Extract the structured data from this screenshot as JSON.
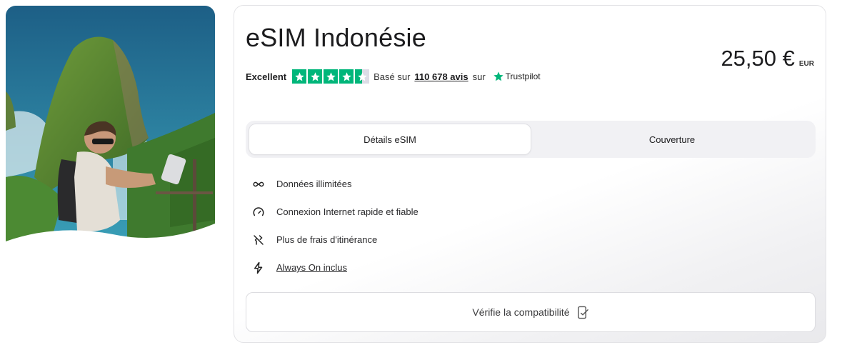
{
  "product": {
    "title": "eSIM Indonésie",
    "price": "25,50 €",
    "currency": "EUR"
  },
  "rating": {
    "label": "Excellent",
    "stars": 4.5,
    "based_on": "Basé sur",
    "count": "110 678 avis",
    "on": "sur",
    "provider": "Trustpilot"
  },
  "tabs": [
    {
      "label": "Détails eSIM",
      "active": true
    },
    {
      "label": "Couverture",
      "active": false
    }
  ],
  "features": [
    {
      "icon": "infinity-icon",
      "label": "Données illimitées"
    },
    {
      "icon": "speedometer-icon",
      "label": "Connexion Internet rapide et fiable"
    },
    {
      "icon": "no-roaming-icon",
      "label": "Plus de frais d'itinérance"
    },
    {
      "icon": "lightning-icon",
      "label": "Always On inclus",
      "link": true
    }
  ],
  "compatibility_button": {
    "label": "Vérifie la compatibilité",
    "icon": "phone-check-icon"
  },
  "colors": {
    "trustpilot_green": "#00b67a",
    "text": "#1c1c1e"
  }
}
